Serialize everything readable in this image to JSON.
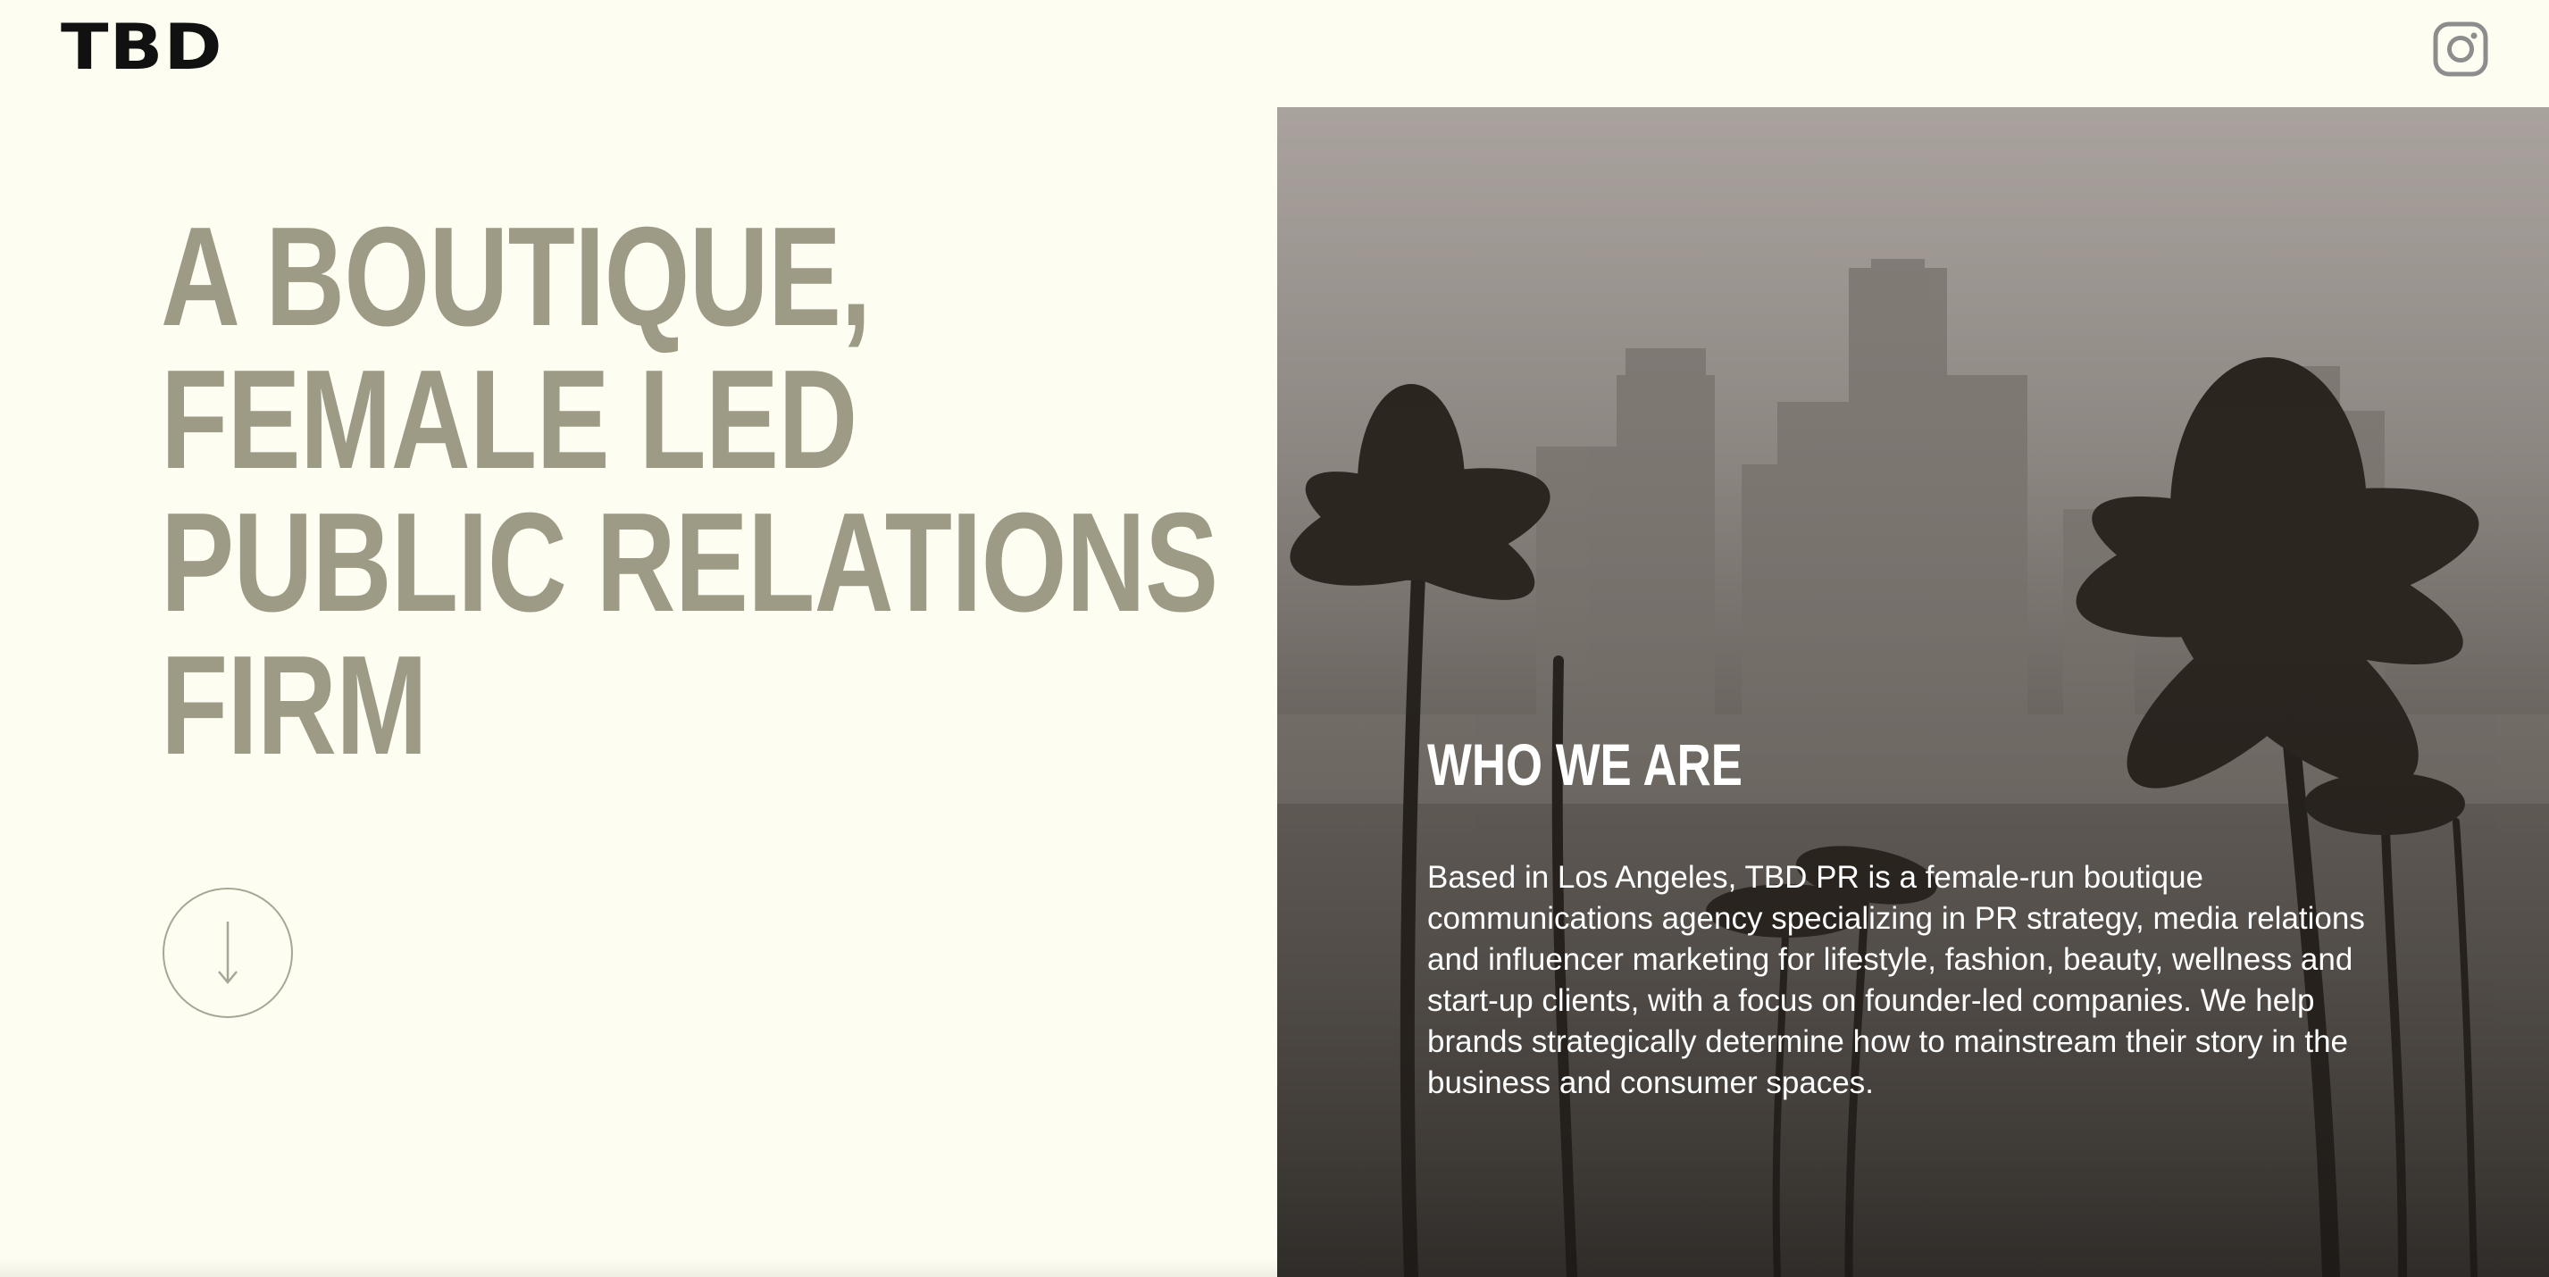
{
  "header": {
    "logo": "TBD",
    "social_icon": "instagram-icon"
  },
  "hero": {
    "lines": [
      "A BOUTIQUE,",
      "FEMALE LED",
      "PUBLIC RELATIONS",
      "FIRM"
    ],
    "scroll_icon": "arrow-down-icon"
  },
  "about": {
    "title": "WHO WE ARE",
    "body": "Based in Los Angeles, TBD PR is a female-run boutique communications agency specializing in PR strategy, media relations and influencer marketing for lifestyle, fashion, beauty, wellness and start-up clients, with a focus on founder-led companies. We help brands strategically determine how to mainstream their story in the business and consumer spaces."
  },
  "colors": {
    "background": "#fdfdf1",
    "hero_text": "#9d9a85",
    "logo": "#111111",
    "about_text": "#ffffff"
  }
}
